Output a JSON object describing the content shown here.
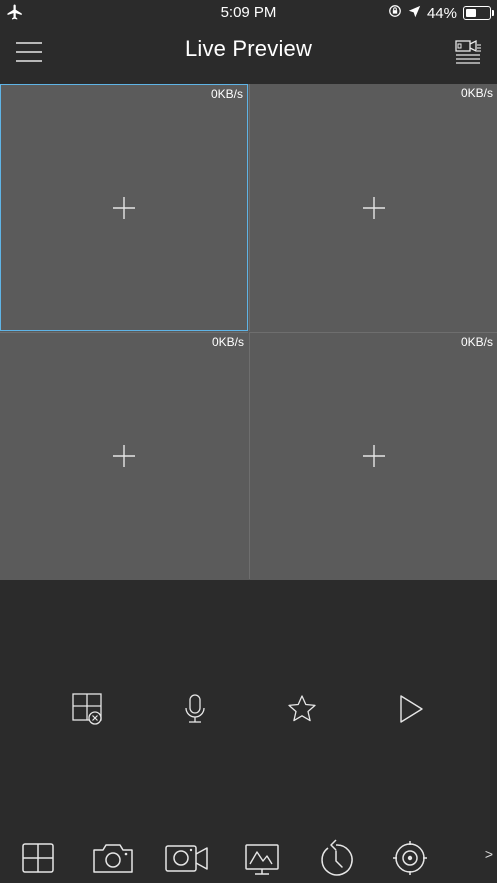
{
  "status_bar": {
    "time": "5:09 PM",
    "battery_percent": "44%",
    "battery_level": 0.44,
    "airplane_icon": "airplane-icon",
    "location_icon": "location-arrow-icon",
    "rotation_lock_icon": "rotation-lock-icon"
  },
  "nav": {
    "title": "Live Preview",
    "menu_icon": "hamburger-menu-icon",
    "device_icon": "device-list-icon"
  },
  "grid": {
    "cells": [
      {
        "rate": "0KB/s",
        "selected": true
      },
      {
        "rate": "0KB/s",
        "selected": false
      },
      {
        "rate": "0KB/s",
        "selected": false
      },
      {
        "rate": "0KB/s",
        "selected": false
      }
    ],
    "accent_color": "#5fb4e6"
  },
  "controls": [
    "close-window-icon",
    "microphone-icon",
    "star-icon",
    "play-icon"
  ],
  "toolbar": {
    "items": [
      "split-screen-icon",
      "snapshot-camera-icon",
      "record-video-icon",
      "image-quality-icon",
      "playback-history-icon",
      "ptz-control-icon"
    ],
    "more_label": ">"
  }
}
